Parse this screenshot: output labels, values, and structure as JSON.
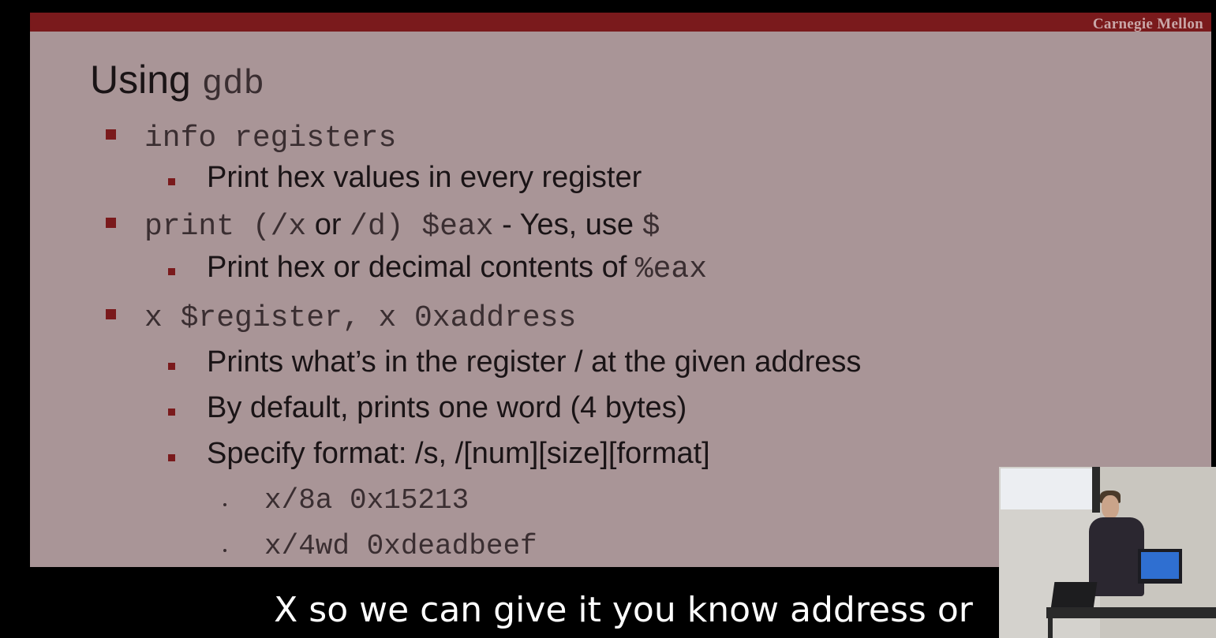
{
  "slide": {
    "brand": "Carnegie Mellon",
    "title_text": "Using ",
    "title_code": "gdb",
    "items": [
      {
        "code": "info registers"
      },
      {
        "text": "Print hex values in every register"
      },
      {
        "code_a": "print (/x",
        "text_a": " or ",
        "code_b": "/d) $eax",
        "text_b": " - Yes, use ",
        "code_c": "$"
      },
      {
        "text": "Print hex or decimal contents of ",
        "code": "%eax"
      },
      {
        "code": "x $register, x 0xaddress"
      },
      {
        "text": "Prints what’s in the register / at the given address"
      },
      {
        "text": "By default, prints one word (4 bytes)"
      },
      {
        "text": "Specify format: /s, /[num][size][format]"
      },
      {
        "code": "x/8a 0x15213"
      },
      {
        "code": "x/4wd 0xdeadbeef"
      }
    ]
  },
  "caption": "X so we can give it you know address or",
  "colors": {
    "background": "#000000",
    "slide_bg": "#a99597",
    "accent": "#7a1a1c",
    "caption": "#ffffff"
  }
}
